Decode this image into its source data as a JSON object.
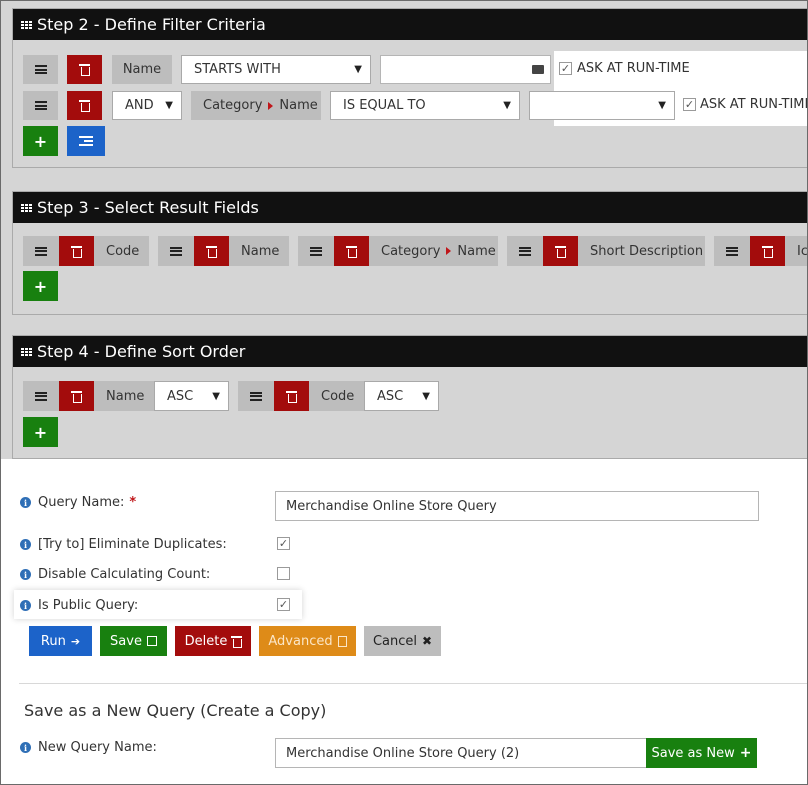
{
  "step2": {
    "title": "Step 2 - Define Filter Criteria",
    "row1": {
      "field": "Name",
      "operator": "STARTS WITH",
      "value": "",
      "ask_label": "ASK AT RUN-TIME",
      "ask_checked": true
    },
    "row2": {
      "logic": "AND",
      "field_parent": "Category",
      "field_child": "Name",
      "operator": "IS EQUAL TO",
      "value": "",
      "ask_label": "ASK AT RUN-TIME",
      "ask_checked": true
    }
  },
  "step3": {
    "title": "Step 3 - Select Result Fields",
    "fields": [
      {
        "label": "Code"
      },
      {
        "label": "Name"
      },
      {
        "parent": "Category",
        "child": "Name"
      },
      {
        "label": "Short Description"
      },
      {
        "label": "Ic"
      }
    ]
  },
  "step4": {
    "title": "Step 4 - Define Sort Order",
    "sorts": [
      {
        "field": "Name",
        "direction": "ASC"
      },
      {
        "field": "Code",
        "direction": "ASC"
      }
    ]
  },
  "form": {
    "query_name_label": "Query Name:",
    "required_mark": "*",
    "query_name_value": "Merchandise Online Store Query",
    "eliminate_duplicates_label": "[Try to] Eliminate Duplicates:",
    "eliminate_duplicates_checked": true,
    "disable_count_label": "Disable Calculating Count:",
    "disable_count_checked": false,
    "public_query_label": "Is Public Query:",
    "public_query_checked": true
  },
  "actions": {
    "run": "Run",
    "save": "Save",
    "delete": "Delete",
    "advanced": "Advanced",
    "cancel": "Cancel"
  },
  "copy": {
    "heading": "Save as a New Query (Create a Copy)",
    "new_name_label": "New Query Name:",
    "new_name_value": "Merchandise Online Store Query (2)",
    "save_as_new": "Save as New"
  },
  "colors": {
    "red": "#a30c0c",
    "green": "#18800f",
    "blue": "#1c63c9",
    "orange": "#de8b18",
    "header": "#111111"
  }
}
